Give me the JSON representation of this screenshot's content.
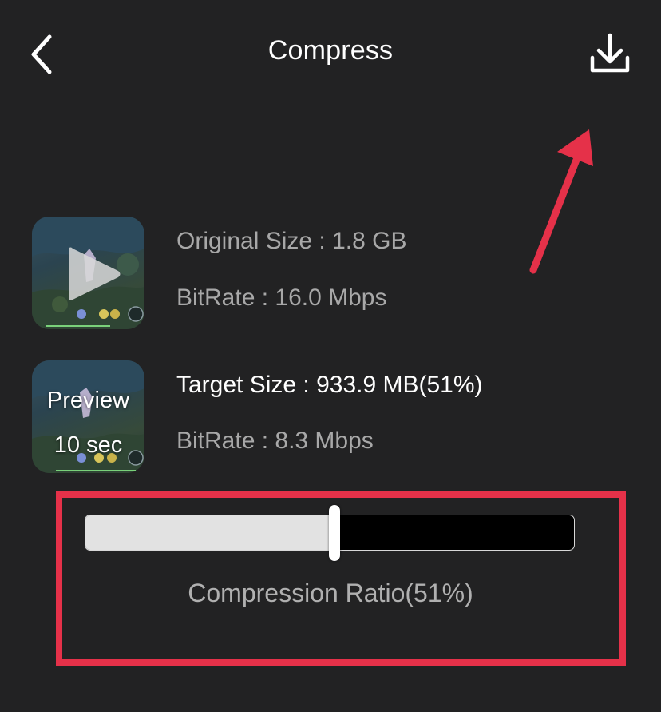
{
  "header": {
    "title": "Compress",
    "back_icon": "chevron-left-icon",
    "download_icon": "download-icon"
  },
  "original": {
    "size_text": "Original Size : 1.8 GB",
    "bitrate_text": "BitRate : 16.0 Mbps",
    "thumbnail_icon": "play-icon"
  },
  "target": {
    "size_text": "Target Size : 933.9 MB(51%)",
    "bitrate_text": "BitRate : 8.3 Mbps",
    "preview_line1": "Preview",
    "preview_line2": "10 sec"
  },
  "compression": {
    "ratio_label": "Compression Ratio(51%)",
    "ratio_value": 0.51
  },
  "colors": {
    "background": "#222223",
    "annotation": "#e53149",
    "slider_fill": "#e2e2e2",
    "slider_empty": "#000000"
  }
}
